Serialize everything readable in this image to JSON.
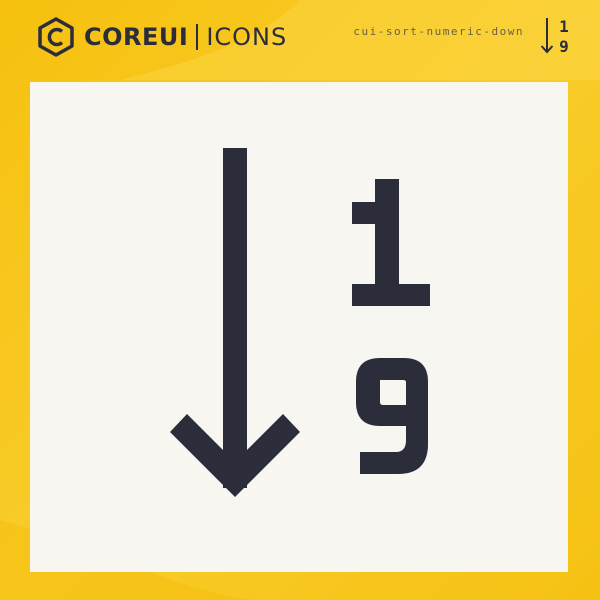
{
  "brand": {
    "core_label": "COREUI",
    "icons_label": "ICONS",
    "logo_icon": "coreui-hexagon-c-icon"
  },
  "icon": {
    "name": "cui-sort-numeric-down",
    "glyph_top": "1",
    "glyph_bottom": "9",
    "preview_icon": "sort-numeric-down-icon"
  },
  "colors": {
    "background": "#f7c51a",
    "card": "#f8f6f0",
    "ink": "#2b2d3b"
  }
}
